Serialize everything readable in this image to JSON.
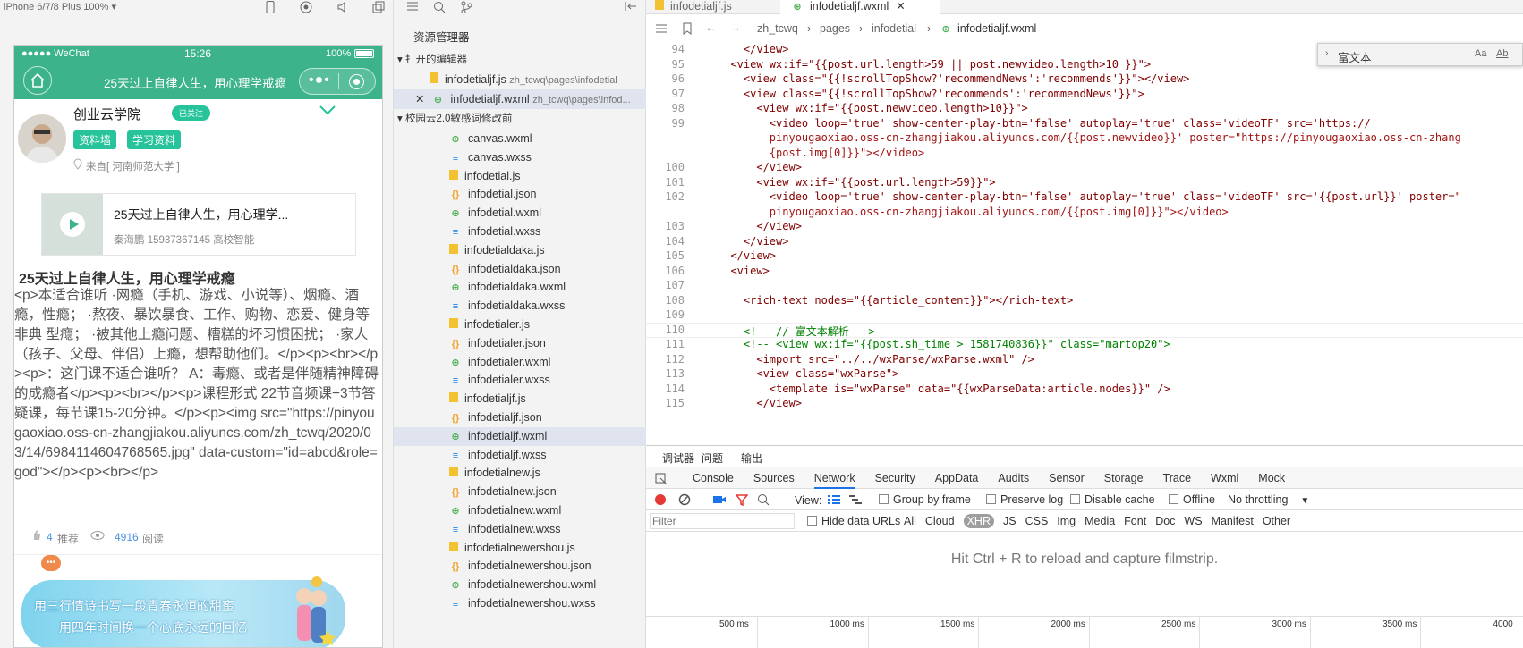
{
  "sim": {
    "device": "iPhone 6/7/8 Plus 100% ▾"
  },
  "phone": {
    "carrier": "●●●●● WeChat",
    "time": "15:26",
    "battery": "100%",
    "nav_title": "25天过上自律人生，用心理学戒瘾"
  },
  "author": {
    "name": "创业云学院",
    "follow": "已关注",
    "tag1": "资料墙",
    "tag2": "学习资料",
    "location": "来自[ 河南师范大学 ]"
  },
  "audio": {
    "title": "25天过上自律人生，用心理学...",
    "meta": "秦海鹏 15937367145 高校智能"
  },
  "article": {
    "title": "25天过上自律人生，用心理学戒瘾",
    "body": "<p>本适合谁听 ·网瘾（手机、游戏、小说等）、烟瘾、酒瘾，性瘾； ·熬夜、暴饮暴食、工作、购物、恋爱、健身等非典 型瘾； ·被其他上瘾问题、糟糕的坏习惯困扰； ·家人（孩子、父母、伴侣）上瘾，想帮助他们。</p><p><br></p><p>：这门课不适合谁听？ A：毒瘾、或者是伴随精神障碍的成瘾者</p><p><br></p><p>课程形式 22节音频课+3节答疑课，每节课15-20分钟。</p><p><img src=\"https://pinyougaoxiao.oss-cn-zhangjiakou.aliyuncs.com/zh_tcwq/2020/03/14/6984114604768565.jpg\" data-custom=\"id=abcd&role=god\"></p><p><br></p>"
  },
  "stats": {
    "recommend_count": "4",
    "recommend_label": "推荐",
    "read_count": "4916",
    "read_label": "阅读"
  },
  "banner": {
    "line1": "用三行情诗书写一段青春永恒的甜蜜",
    "line2": "用四年时间换一个心底永远的回忆"
  },
  "explorer": {
    "title": "资源管理器",
    "open_section": "打开的编辑器",
    "project_section": "校园云2.0敏感词修改前",
    "open_files": [
      {
        "name": "infodetialjf.js",
        "path": "zh_tcwq\\pages\\infodetial"
      },
      {
        "name": "infodetialjf.wxml",
        "path": "zh_tcwq\\pages\\infod..."
      }
    ],
    "files": [
      "canvas.wxml",
      "canvas.wxss",
      "infodetial.js",
      "infodetial.json",
      "infodetial.wxml",
      "infodetial.wxss",
      "infodetialdaka.js",
      "infodetialdaka.json",
      "infodetialdaka.wxml",
      "infodetialdaka.wxss",
      "infodetialer.js",
      "infodetialer.json",
      "infodetialer.wxml",
      "infodetialer.wxss",
      "infodetialjf.js",
      "infodetialjf.json",
      "infodetialjf.wxml",
      "infodetialjf.wxss",
      "infodetialnew.js",
      "infodetialnew.json",
      "infodetialnew.wxml",
      "infodetialnew.wxss",
      "infodetialnewershou.js",
      "infodetialnewershou.json",
      "infodetialnewershou.wxml",
      "infodetialnewershou.wxss"
    ]
  },
  "editor": {
    "tab1": "infodetialjf.js",
    "tab2": "infodetialjf.wxml",
    "crumb": [
      "zh_tcwq",
      "pages",
      "infodetial",
      "infodetialjf.wxml"
    ],
    "find_text": "富文本",
    "lines": [
      {
        "n": "94",
        "t": "    </view>"
      },
      {
        "n": "95",
        "t": "  <view wx:if=\"{{post.url.length>59 || post.newvideo.length>10 }}\">"
      },
      {
        "n": "96",
        "t": "    <view class=\"{{!scrollTopShow?'recommendNews':'recommends'}}\"></view>"
      },
      {
        "n": "97",
        "t": "    <view class=\"{{!scrollTopShow?'recommends':'recommendNews'}}\">"
      },
      {
        "n": "98",
        "t": "      <view wx:if=\"{{post.newvideo.length>10}}\">"
      },
      {
        "n": "99",
        "t": "        <video loop='true' show-center-play-btn='false' autoplay='true' class='videoTF' src='https://"
      },
      {
        "n": "",
        "t": "        pinyougaoxiao.oss-cn-zhangjiakou.aliyuncs.com/{{post.newvideo}}' poster=\"https://pinyougaoxiao.oss-cn-zhang"
      },
      {
        "n": "",
        "t": "        {post.img[0]}}\"></video>"
      },
      {
        "n": "100",
        "t": "      </view>"
      },
      {
        "n": "101",
        "t": "      <view wx:if=\"{{post.url.length>59}}\">"
      },
      {
        "n": "102",
        "t": "        <video loop='true' show-center-play-btn='false' autoplay='true' class='videoTF' src='{{post.url}}' poster=\""
      },
      {
        "n": "",
        "t": "        pinyougaoxiao.oss-cn-zhangjiakou.aliyuncs.com/{{post.img[0]}}\"></video>"
      },
      {
        "n": "103",
        "t": "      </view>"
      },
      {
        "n": "104",
        "t": "    </view>"
      },
      {
        "n": "105",
        "t": "  </view>"
      },
      {
        "n": "106",
        "t": "  <view>"
      },
      {
        "n": "107",
        "t": ""
      },
      {
        "n": "108",
        "t": "    <rich-text nodes=\"{{article_content}}\"></rich-text>"
      },
      {
        "n": "109",
        "t": ""
      },
      {
        "n": "110",
        "t": "    <!-- // 富文本解析 -->"
      },
      {
        "n": "111",
        "t": "    <!-- <view wx:if=\"{{post.sh_time > 1581740836}}\" class=\"martop20\">"
      },
      {
        "n": "112",
        "t": "      <import src=\"../../wxParse/wxParse.wxml\" />"
      },
      {
        "n": "113",
        "t": "      <view class=\"wxParse\">"
      },
      {
        "n": "114",
        "t": "        <template is=\"wxParse\" data=\"{{wxParseData:article.nodes}}\" />"
      },
      {
        "n": "115",
        "t": "      </view>"
      }
    ]
  },
  "devtools": {
    "top_tabs": [
      "调试器",
      "问题",
      "输出"
    ],
    "tabs": [
      "Console",
      "Sources",
      "Network",
      "Security",
      "AppData",
      "Audits",
      "Sensor",
      "Storage",
      "Trace",
      "Wxml",
      "Mock"
    ],
    "view_label": "View:",
    "group_by_frame": "Group by frame",
    "preserve_log": "Preserve log",
    "disable_cache": "Disable cache",
    "offline": "Offline",
    "throttling": "No throttling",
    "filter_placeholder": "Filter",
    "hide_data_urls": "Hide data URLs",
    "types": [
      "All",
      "Cloud",
      "XHR",
      "JS",
      "CSS",
      "Img",
      "Media",
      "Font",
      "Doc",
      "WS",
      "Manifest",
      "Other"
    ],
    "hint": "Hit Ctrl + R to reload and capture filmstrip.",
    "ticks": [
      "500 ms",
      "1000 ms",
      "1500 ms",
      "2000 ms",
      "2500 ms",
      "3000 ms",
      "3500 ms",
      "4000"
    ]
  },
  "colors": {
    "wechat_green": "#3cb38a",
    "tag_green": "#27c39a",
    "link_blue": "#1a73e8"
  }
}
